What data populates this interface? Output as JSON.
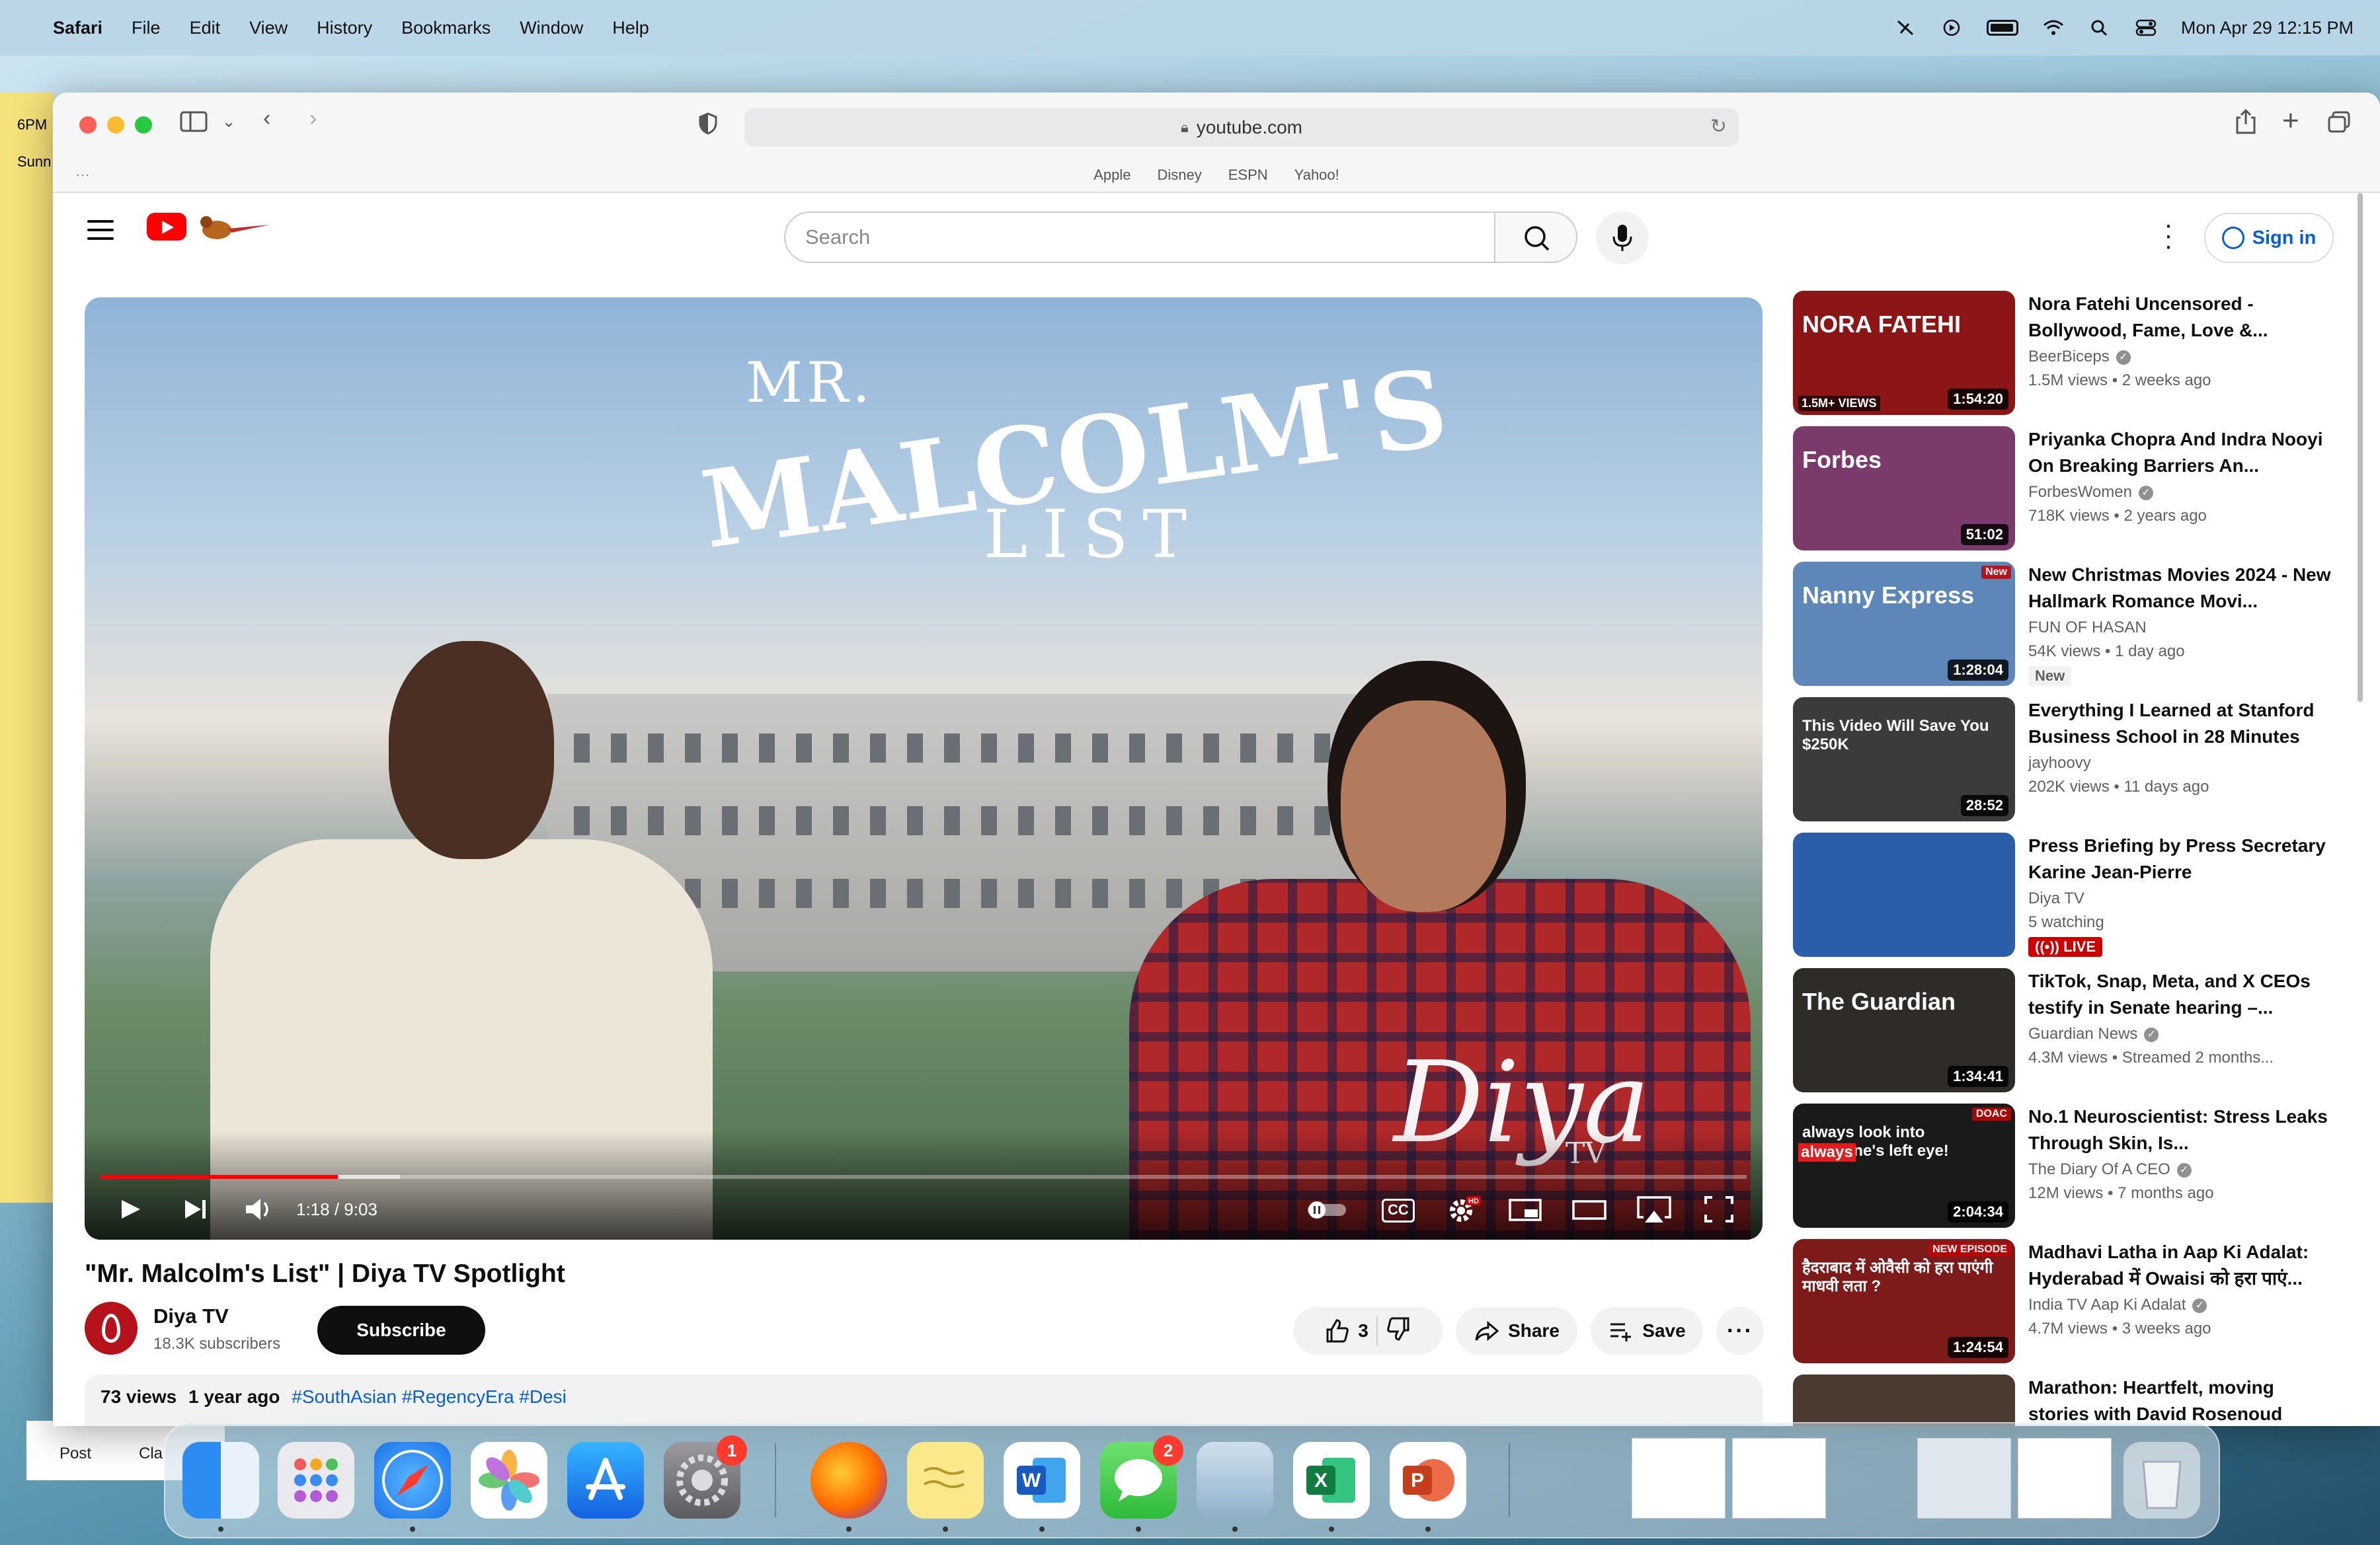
{
  "menubar": {
    "app_name": "Safari",
    "items": [
      "File",
      "Edit",
      "View",
      "History",
      "Bookmarks",
      "Window",
      "Help"
    ],
    "datetime": "Mon Apr 29  12:15 PM"
  },
  "desktop": {
    "peek_time": "6PM",
    "peek_word": "Sunn",
    "bottom_items": [
      "Post",
      "Cla"
    ]
  },
  "safari": {
    "url": "youtube.com",
    "favorites": [
      "Apple",
      "Disney",
      "ESPN",
      "Yahoo!"
    ]
  },
  "youtube": {
    "search_placeholder": "Search",
    "sign_in": "Sign in",
    "player": {
      "art_line1": "MR.",
      "art_line2": "MALCOLM'S",
      "art_line3": "LIST",
      "watermark": "Diya",
      "watermark_sub": "TV",
      "time": "1:18 / 9:03",
      "progress_played": 0.144,
      "progress_buffered": 0.182,
      "cc_label": "CC",
      "hd_label": "HD"
    },
    "video": {
      "title": "\"Mr. Malcolm's List\" | Diya TV Spotlight",
      "channel": "Diya TV",
      "subscribers": "18.3K subscribers",
      "subscribe": "Subscribe",
      "likes": "3",
      "share": "Share",
      "save": "Save",
      "views": "73 views",
      "age": "1 year ago",
      "tags": "#SouthAsian #RegencyEra #Desi"
    },
    "recommendations": [
      {
        "title": "Nora Fatehi Uncensored - Bollywood, Fame, Love &...",
        "channel": "BeerBiceps",
        "verified": true,
        "meta": "1.5M views • 2 weeks ago",
        "duration": "1:54:20",
        "thumb_text": "NORA FATEHI",
        "thumb_sub": "1.5M+ VIEWS",
        "thumb_color": "#8c1616"
      },
      {
        "title": "Priyanka Chopra And Indra Nooyi On Breaking Barriers An...",
        "channel": "ForbesWomen",
        "verified": true,
        "meta": "718K views • 2 years ago",
        "duration": "51:02",
        "thumb_text": "Forbes",
        "thumb_color": "#7a3b6a"
      },
      {
        "title": "New Christmas Movies 2024 - New Hallmark Romance Movi...",
        "channel": "FUN OF HASAN",
        "verified": false,
        "meta": "54K views • 1 day ago",
        "duration": "1:28:04",
        "badge": "New",
        "thumb_text": "Nanny Express",
        "thumb_corner": "New",
        "thumb_color": "#5d87b8"
      },
      {
        "title": "Everything I Learned at Stanford Business School in 28 Minutes",
        "channel": "jayhoovy",
        "verified": false,
        "meta": "202K views • 11 days ago",
        "duration": "28:52",
        "thumb_text": "This Video Will Save You $250K",
        "thumb_color": "#3b3b3b"
      },
      {
        "title": "Press Briefing by Press Secretary Karine Jean-Pierre",
        "channel": "Diya TV",
        "verified": false,
        "meta": "5 watching",
        "live": "LIVE",
        "thumb_color": "#2b5da8"
      },
      {
        "title": "TikTok, Snap, Meta, and X CEOs testify in Senate hearing –...",
        "channel": "Guardian News",
        "verified": true,
        "meta": "4.3M views • Streamed 2 months...",
        "duration": "1:34:41",
        "thumb_text": "The Guardian",
        "thumb_color": "#2e2b29"
      },
      {
        "title": "No.1 Neuroscientist: Stress Leaks Through Skin, Is...",
        "channel": "The Diary Of A CEO",
        "verified": true,
        "meta": "12M views • 7 months ago",
        "duration": "2:04:34",
        "thumb_text": "always look into someone's left eye!",
        "thumb_highlight": "always",
        "thumb_corner": "DOAC",
        "thumb_color": "#1a1a1a"
      },
      {
        "title": "Madhavi Latha in Aap Ki Adalat: Hyderabad में Owaisi को हरा पाएं...",
        "channel": "India TV Aap Ki Adalat",
        "verified": true,
        "meta": "4.7M views • 3 weeks ago",
        "duration": "1:24:54",
        "thumb_text": "हैदराबाद में ओवैसी को हरा पाएंगी माधवी लता ?",
        "thumb_corner": "NEW EPISODE",
        "thumb_color": "#7d1a1a"
      },
      {
        "title": "Marathon: Heartfelt, moving stories with David Rosenoud",
        "channel": "",
        "verified": false,
        "meta": "",
        "thumb_color": "#4a3a30"
      }
    ]
  },
  "dock": {
    "badges": {
      "system_settings": "1",
      "messages": "2"
    }
  }
}
